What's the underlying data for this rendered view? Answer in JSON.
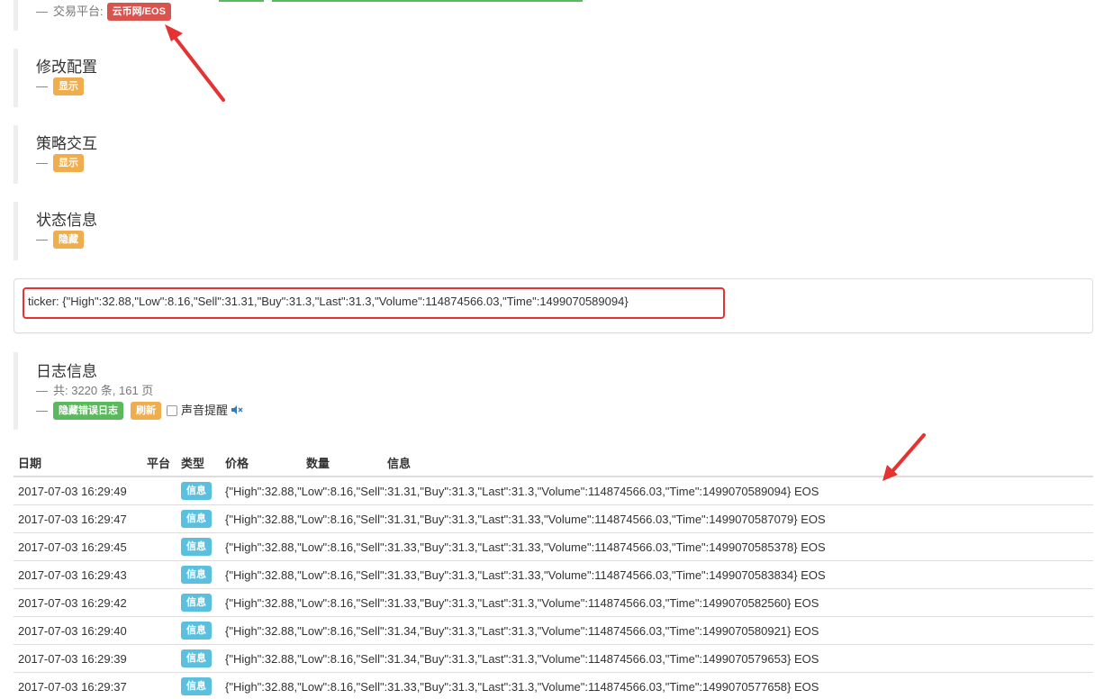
{
  "platform": {
    "label": "交易平台:",
    "badge": "云币网/EOS"
  },
  "config_section": {
    "title": "修改配置",
    "toggle": "显示"
  },
  "interaction_section": {
    "title": "策略交互",
    "toggle": "显示"
  },
  "status_section": {
    "title": "状态信息",
    "toggle": "隐藏"
  },
  "ticker": {
    "text": "ticker: {\"High\":32.88,\"Low\":8.16,\"Sell\":31.31,\"Buy\":31.3,\"Last\":31.3,\"Volume\":114874566.03,\"Time\":1499070589094}"
  },
  "log_section": {
    "title": "日志信息",
    "summary": "共: 3220 条, 161 页",
    "hide_errors_button": "隐藏错误日志",
    "refresh_button": "刷新",
    "sound_alert_label": "声音提醒"
  },
  "log_table": {
    "headers": {
      "date": "日期",
      "platform": "平台",
      "type": "类型",
      "price": "价格",
      "amount": "数量",
      "info": "信息"
    },
    "rows": [
      {
        "date": "2017-07-03 16:29:49",
        "type": "信息",
        "info": "{\"High\":32.88,\"Low\":8.16,\"Sell\":31.31,\"Buy\":31.3,\"Last\":31.3,\"Volume\":114874566.03,\"Time\":1499070589094} EOS"
      },
      {
        "date": "2017-07-03 16:29:47",
        "type": "信息",
        "info": "{\"High\":32.88,\"Low\":8.16,\"Sell\":31.31,\"Buy\":31.3,\"Last\":31.33,\"Volume\":114874566.03,\"Time\":1499070587079} EOS"
      },
      {
        "date": "2017-07-03 16:29:45",
        "type": "信息",
        "info": "{\"High\":32.88,\"Low\":8.16,\"Sell\":31.33,\"Buy\":31.3,\"Last\":31.33,\"Volume\":114874566.03,\"Time\":1499070585378} EOS"
      },
      {
        "date": "2017-07-03 16:29:43",
        "type": "信息",
        "info": "{\"High\":32.88,\"Low\":8.16,\"Sell\":31.33,\"Buy\":31.3,\"Last\":31.33,\"Volume\":114874566.03,\"Time\":1499070583834} EOS"
      },
      {
        "date": "2017-07-03 16:29:42",
        "type": "信息",
        "info": "{\"High\":32.88,\"Low\":8.16,\"Sell\":31.33,\"Buy\":31.3,\"Last\":31.3,\"Volume\":114874566.03,\"Time\":1499070582560} EOS"
      },
      {
        "date": "2017-07-03 16:29:40",
        "type": "信息",
        "info": "{\"High\":32.88,\"Low\":8.16,\"Sell\":31.34,\"Buy\":31.3,\"Last\":31.3,\"Volume\":114874566.03,\"Time\":1499070580921} EOS"
      },
      {
        "date": "2017-07-03 16:29:39",
        "type": "信息",
        "info": "{\"High\":32.88,\"Low\":8.16,\"Sell\":31.34,\"Buy\":31.3,\"Last\":31.3,\"Volume\":114874566.03,\"Time\":1499070579653} EOS"
      },
      {
        "date": "2017-07-03 16:29:37",
        "type": "信息",
        "info": "{\"High\":32.88,\"Low\":8.16,\"Sell\":31.33,\"Buy\":31.3,\"Last\":31.3,\"Volume\":114874566.03,\"Time\":1499070577658} EOS"
      }
    ]
  },
  "icons": {
    "speaker": "speaker-muted-icon"
  },
  "colors": {
    "badge_red": "#d9534f",
    "badge_orange": "#f0ad4e",
    "badge_green": "#5cb85c",
    "badge_blue": "#5bc0de",
    "annotation_red": "#e53333"
  }
}
